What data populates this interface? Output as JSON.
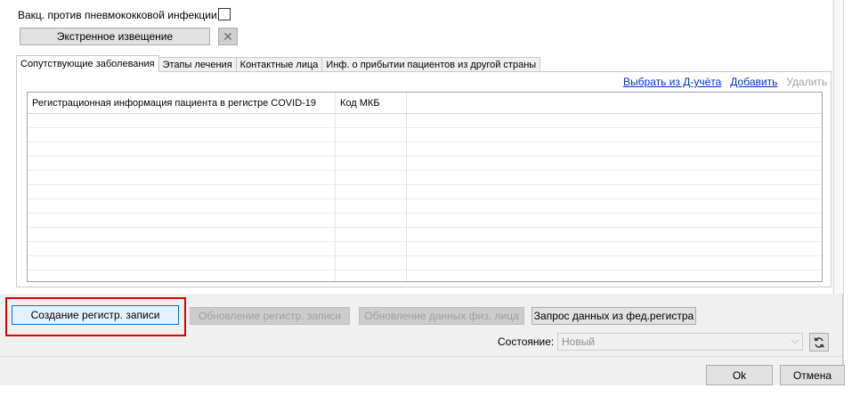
{
  "form": {
    "vaccine_label": "Вакц. против пневмококковой инфекции:",
    "vaccine_checked": false,
    "emergency_button": "Экстренное извещение",
    "clear_button": "✕"
  },
  "tabs": [
    {
      "label": "Сопутствующие заболевания",
      "active": true
    },
    {
      "label": "Этапы лечения",
      "active": false
    },
    {
      "label": "Контактные лица",
      "active": false
    },
    {
      "label": "Инф. о прибытии пациентов из другой страны",
      "active": false
    }
  ],
  "actions": {
    "select": "Выбрать из Д-учёта",
    "add": "Добавить",
    "delete": "Удалить"
  },
  "grid": {
    "columns": [
      "Регистрационная информация пациента в регистре COVID-19",
      "Код МКБ",
      ""
    ],
    "rows": []
  },
  "buttons": {
    "create": "Создание регистр. записи",
    "update": "Обновление регистр. записи",
    "update_person": "Обновление данных физ. лица",
    "request_fed": "Запрос данных из фед.регистра",
    "ok": "Ok",
    "cancel": "Отмена"
  },
  "state": {
    "label": "Состояние:",
    "value": "Новый"
  },
  "colors": {
    "highlight": "#e00000",
    "link": "#0033cc"
  }
}
